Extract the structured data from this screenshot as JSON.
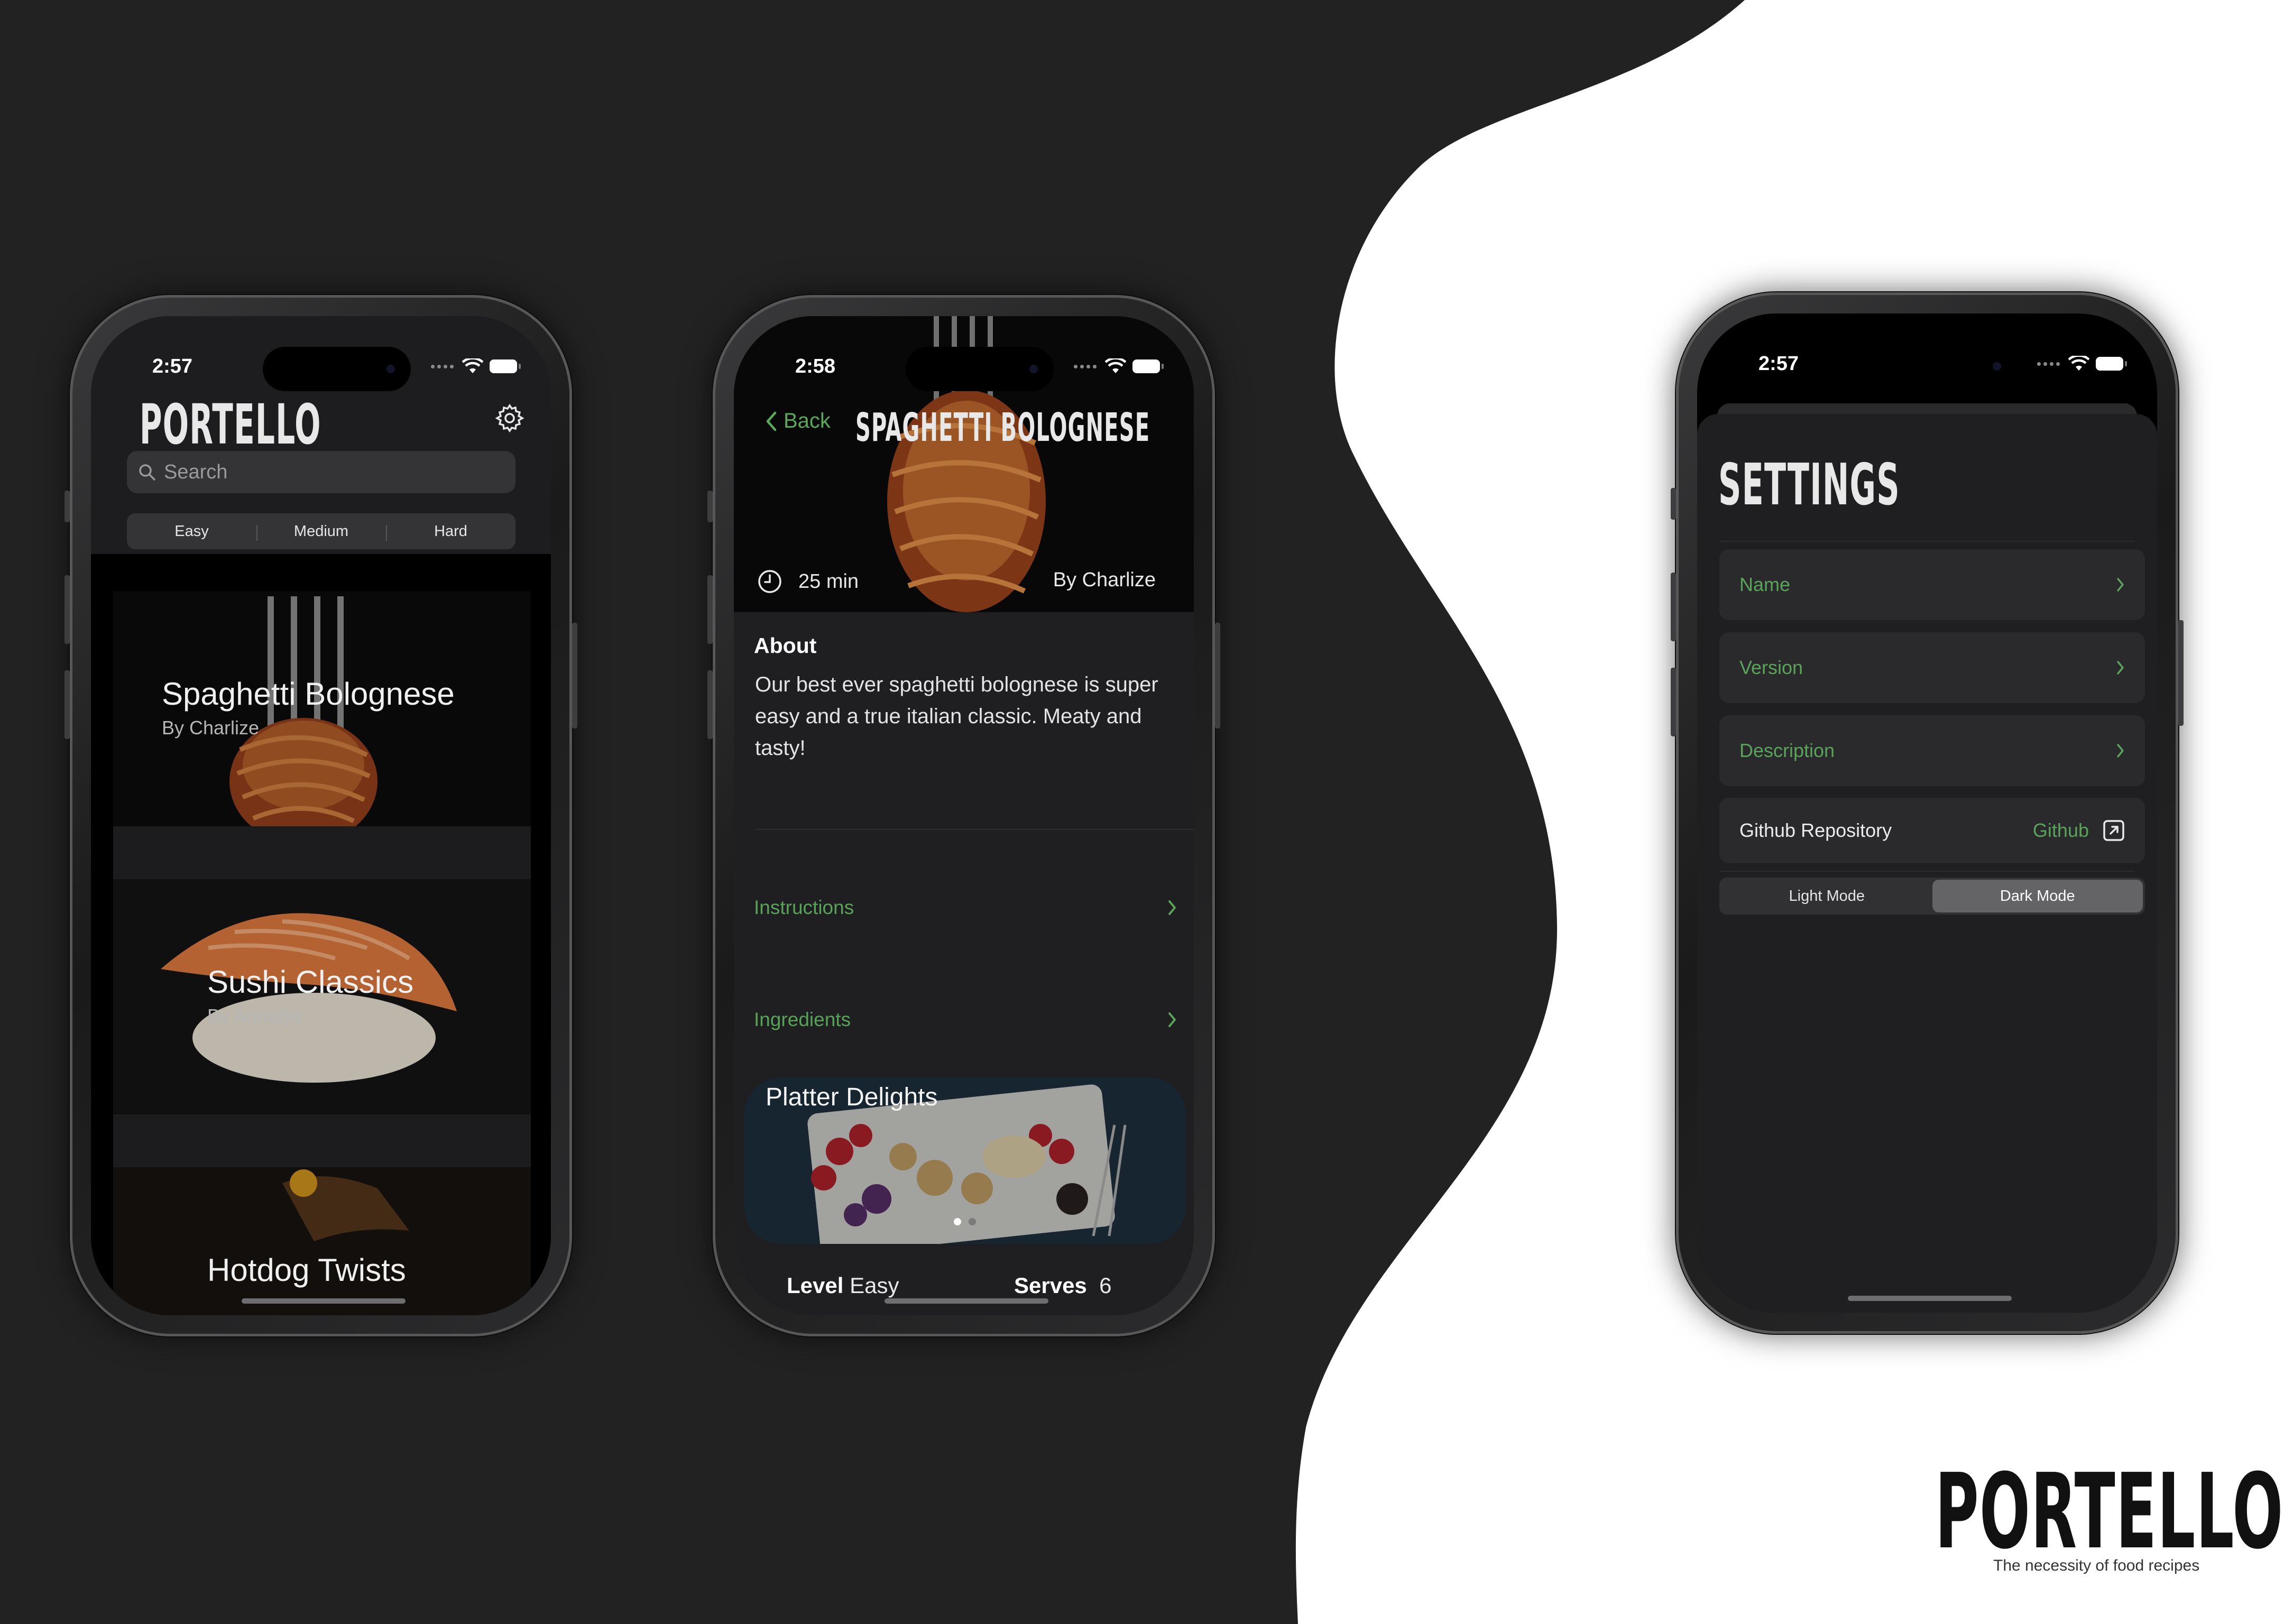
{
  "phone_home": {
    "time": "2:57",
    "app_title": "Portello",
    "search_placeholder": "Search",
    "difficulty_filters": [
      "Easy",
      "Medium",
      "Hard"
    ],
    "recipes": [
      {
        "title": "Spaghetti Bolognese",
        "author": "By Charlize"
      },
      {
        "title": "Sushi Classics",
        "author": "By Annatjie"
      },
      {
        "title": "Hotdog Twists",
        "author": ""
      }
    ]
  },
  "phone_detail": {
    "time": "2:58",
    "back_label": "Back",
    "title": "Spaghetti Bolognese",
    "duration": "25 min",
    "author": "By Charlize",
    "about_heading": "About",
    "about_text": "Our best ever spaghetti bolognese is super easy and a true italian classic. Meaty and tasty!",
    "links": [
      "Instructions",
      "Ingredients"
    ],
    "carousel": {
      "title": "Platter Delights",
      "pages": 2,
      "active_page": 1
    },
    "level_label": "Level",
    "level_value": "Easy",
    "serves_label": "Serves",
    "serves_value": "6"
  },
  "phone_settings": {
    "time": "2:57",
    "title": "Settings",
    "rows": [
      "Name",
      "Version",
      "Description"
    ],
    "repo_label": "Github Repository",
    "repo_link": "Github",
    "modes": [
      "Light Mode",
      "Dark Mode"
    ],
    "selected_mode": "Dark Mode"
  },
  "branding": {
    "logo": "Portello",
    "tagline": "The necessity of food recipes"
  },
  "colors": {
    "background_dark": "#222222",
    "background_light": "#ffffff",
    "accent_green": "#5aa35a",
    "screen_surface": "#1f1f21"
  }
}
